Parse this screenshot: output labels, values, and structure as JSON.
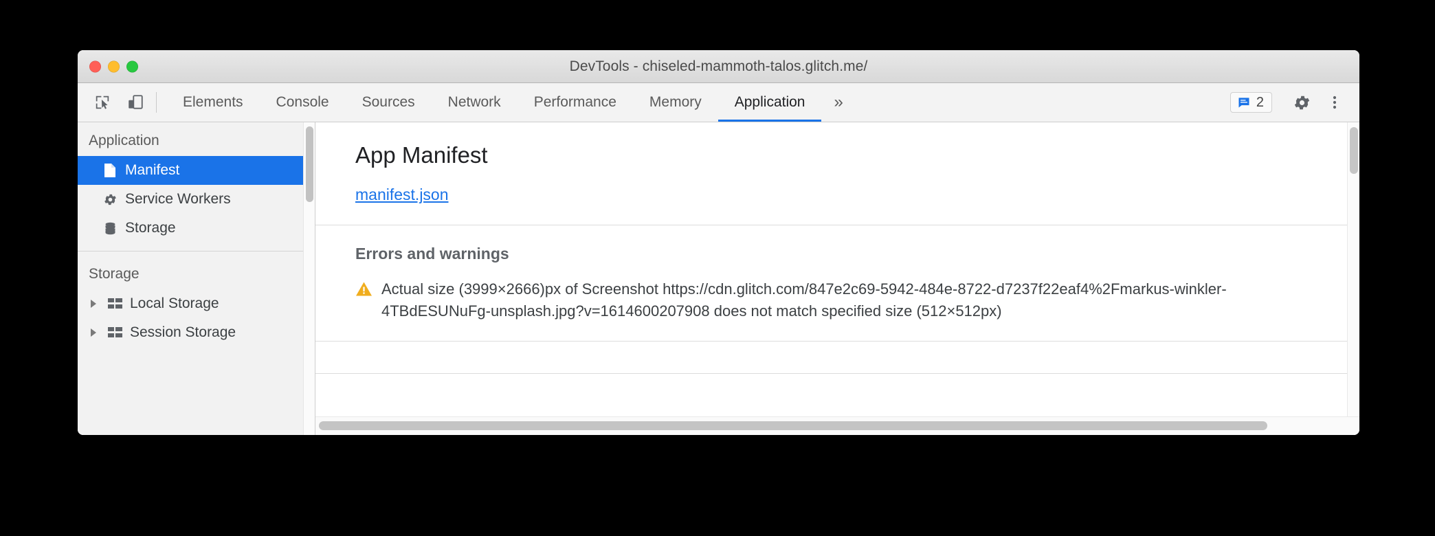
{
  "window": {
    "title": "DevTools - chiseled-mammoth-talos.glitch.me/",
    "traffic_lights": [
      "close",
      "minimize",
      "zoom"
    ]
  },
  "toolbar": {
    "icons": [
      {
        "name": "inspect-element-icon",
        "label": "Inspect element"
      },
      {
        "name": "device-toolbar-icon",
        "label": "Toggle device toolbar"
      }
    ],
    "tabs": [
      {
        "label": "Elements",
        "active": false
      },
      {
        "label": "Console",
        "active": false
      },
      {
        "label": "Sources",
        "active": false
      },
      {
        "label": "Network",
        "active": false
      },
      {
        "label": "Performance",
        "active": false
      },
      {
        "label": "Memory",
        "active": false
      },
      {
        "label": "Application",
        "active": true
      }
    ],
    "overflow_label": "»",
    "message_badge": {
      "icon": "message-icon",
      "count": "2"
    },
    "settings_label": "Settings",
    "more_options_label": "Customize and control DevTools",
    "active_tab_accent": "#1a73e8"
  },
  "sidebar": {
    "groups": [
      {
        "title": "Application",
        "items": [
          {
            "label": "Manifest",
            "icon": "document-icon",
            "selected": true,
            "expandable": false
          },
          {
            "label": "Service Workers",
            "icon": "gear-icon",
            "selected": false,
            "expandable": false
          },
          {
            "label": "Storage",
            "icon": "database-icon",
            "selected": false,
            "expandable": false
          }
        ]
      },
      {
        "title": "Storage",
        "items": [
          {
            "label": "Local Storage",
            "icon": "table-icon",
            "selected": false,
            "expandable": true
          },
          {
            "label": "Session Storage",
            "icon": "table-icon",
            "selected": false,
            "expandable": true
          }
        ]
      }
    ],
    "selected_bg": "#1a73e8"
  },
  "main": {
    "panel_title": "App Manifest",
    "manifest_link": "manifest.json",
    "errors_section_title": "Errors and warnings",
    "warning": {
      "icon": "warning-triangle-icon",
      "color": "#f0ad1e",
      "text": "Actual size (3999×2666)px of Screenshot https://cdn.glitch.com/847e2c69-5942-484e-8722-d7237f22eaf4%2Fmarkus-winkler-4TBdESUNuFg-unsplash.jpg?v=1614600207908 does not match specified size (512×512px)"
    }
  }
}
